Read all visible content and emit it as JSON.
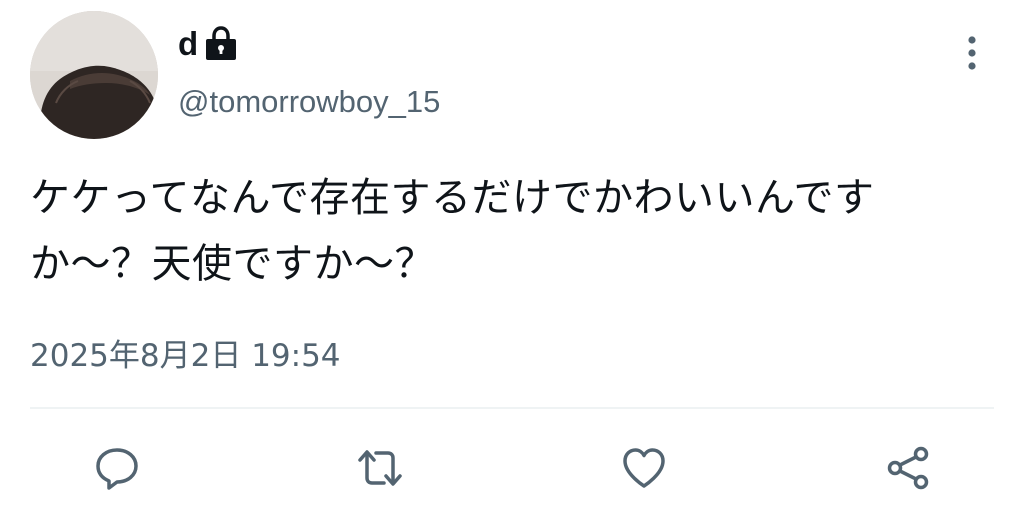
{
  "author": {
    "display_name": "d",
    "handle": "@tomorrowboy_15",
    "protected_icon": "lock-icon",
    "avatar_icon": "avatar-photo"
  },
  "menu": {
    "more_icon": "more-vertical-icon"
  },
  "tweet": {
    "lines": [
      "ケケってなんで存在するだけでかわいいんです",
      "か〜？天使ですか〜？"
    ],
    "timestamp": "2025年8月2日 19:54"
  },
  "actions": [
    {
      "name": "reply",
      "icon": "reply-icon"
    },
    {
      "name": "repost",
      "icon": "repost-icon"
    },
    {
      "name": "like",
      "icon": "heart-icon"
    },
    {
      "name": "share",
      "icon": "share-icon"
    }
  ],
  "colors": {
    "text_primary": "#0f1419",
    "text_secondary": "#536471",
    "divider": "#eff3f4",
    "background": "#ffffff"
  }
}
